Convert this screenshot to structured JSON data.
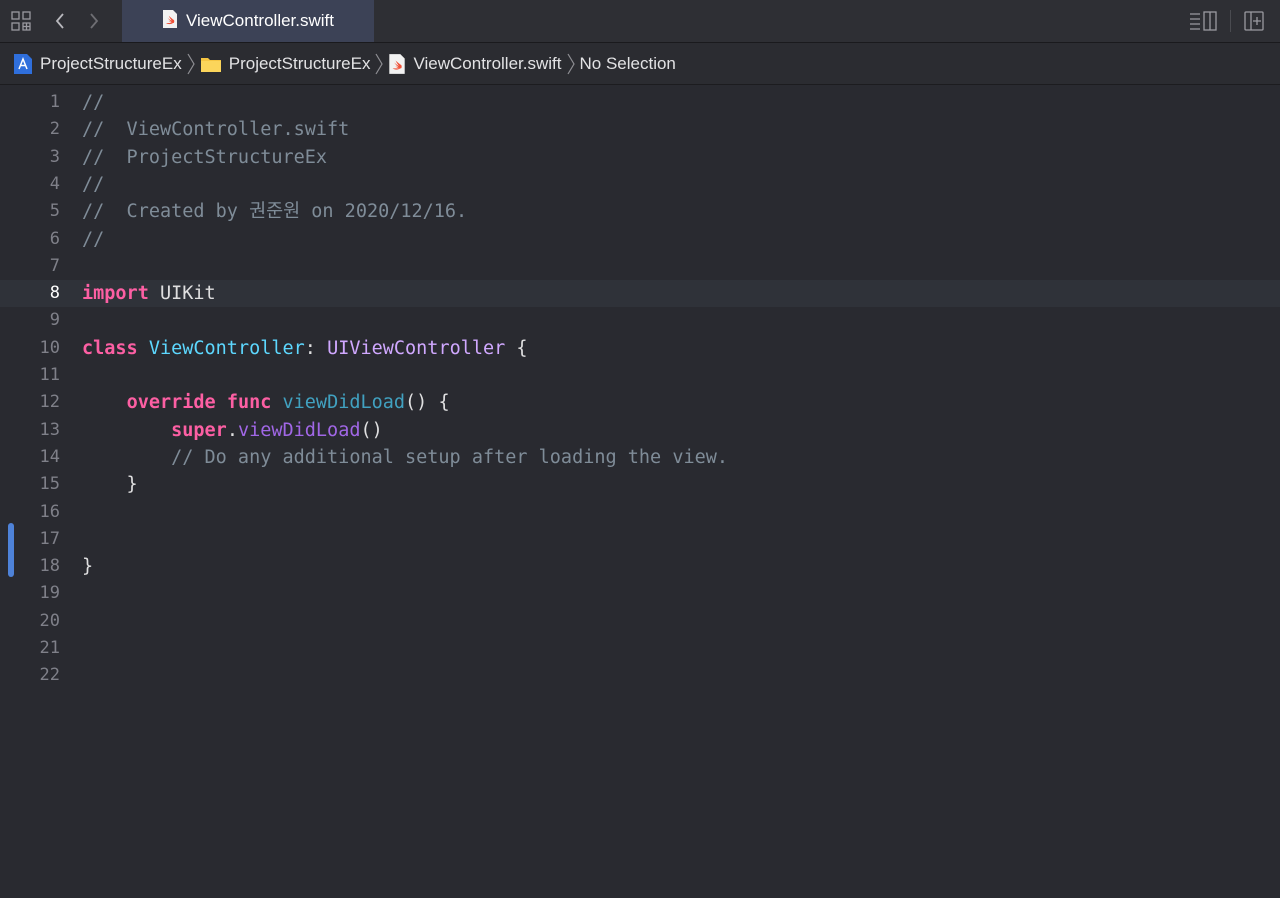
{
  "tabbar": {
    "active_tab": "ViewController.swift"
  },
  "jumpbar": {
    "crumbs": [
      {
        "label": "ProjectStructureEx",
        "icon": "project-icon"
      },
      {
        "label": "ProjectStructureEx",
        "icon": "folder-icon"
      },
      {
        "label": "ViewController.swift",
        "icon": "swift-file-icon"
      },
      {
        "label": "No Selection",
        "icon": ""
      }
    ]
  },
  "editor": {
    "current_line": 8,
    "lines": [
      {
        "n": "1",
        "tokens": [
          {
            "t": "//",
            "k": "c-comment"
          }
        ]
      },
      {
        "n": "2",
        "tokens": [
          {
            "t": "//  ViewController.swift",
            "k": "c-comment"
          }
        ]
      },
      {
        "n": "3",
        "tokens": [
          {
            "t": "//  ProjectStructureEx",
            "k": "c-comment"
          }
        ]
      },
      {
        "n": "4",
        "tokens": [
          {
            "t": "//",
            "k": "c-comment"
          }
        ]
      },
      {
        "n": "5",
        "tokens": [
          {
            "t": "//  Created by 권준원 on 2020/12/16.",
            "k": "c-comment"
          }
        ]
      },
      {
        "n": "6",
        "tokens": [
          {
            "t": "//",
            "k": "c-comment"
          }
        ]
      },
      {
        "n": "7",
        "tokens": []
      },
      {
        "n": "8",
        "tokens": [
          {
            "t": "import",
            "k": "c-kw"
          },
          {
            "t": " UIKit",
            "k": ""
          }
        ]
      },
      {
        "n": "9",
        "tokens": []
      },
      {
        "n": "10",
        "tokens": [
          {
            "t": "class",
            "k": "c-kw"
          },
          {
            "t": " ",
            "k": ""
          },
          {
            "t": "ViewController",
            "k": "c-type"
          },
          {
            "t": ": ",
            "k": ""
          },
          {
            "t": "UIViewController",
            "k": "c-type2"
          },
          {
            "t": " {",
            "k": ""
          }
        ]
      },
      {
        "n": "11",
        "tokens": []
      },
      {
        "n": "12",
        "tokens": [
          {
            "t": "    ",
            "k": ""
          },
          {
            "t": "override",
            "k": "c-kw"
          },
          {
            "t": " ",
            "k": ""
          },
          {
            "t": "func",
            "k": "c-kw"
          },
          {
            "t": " ",
            "k": ""
          },
          {
            "t": "viewDidLoad",
            "k": "c-func"
          },
          {
            "t": "() {",
            "k": ""
          }
        ]
      },
      {
        "n": "13",
        "tokens": [
          {
            "t": "        ",
            "k": ""
          },
          {
            "t": "super",
            "k": "c-kw"
          },
          {
            "t": ".",
            "k": ""
          },
          {
            "t": "viewDidLoad",
            "k": "c-method"
          },
          {
            "t": "()",
            "k": ""
          }
        ]
      },
      {
        "n": "14",
        "tokens": [
          {
            "t": "        ",
            "k": ""
          },
          {
            "t": "// Do any additional setup after loading the view.",
            "k": "c-comment"
          }
        ]
      },
      {
        "n": "15",
        "tokens": [
          {
            "t": "    }",
            "k": ""
          }
        ]
      },
      {
        "n": "16",
        "tokens": []
      },
      {
        "n": "17",
        "tokens": []
      },
      {
        "n": "18",
        "tokens": [
          {
            "t": "}",
            "k": ""
          }
        ]
      },
      {
        "n": "19",
        "tokens": []
      },
      {
        "n": "20",
        "tokens": []
      },
      {
        "n": "21",
        "tokens": []
      },
      {
        "n": "22",
        "tokens": []
      }
    ]
  },
  "colors": {
    "background": "#292a30",
    "keyword": "#fc5fa3",
    "comment": "#7f8c98",
    "type": "#5dd8ff",
    "change_bar": "#4e82d8"
  }
}
